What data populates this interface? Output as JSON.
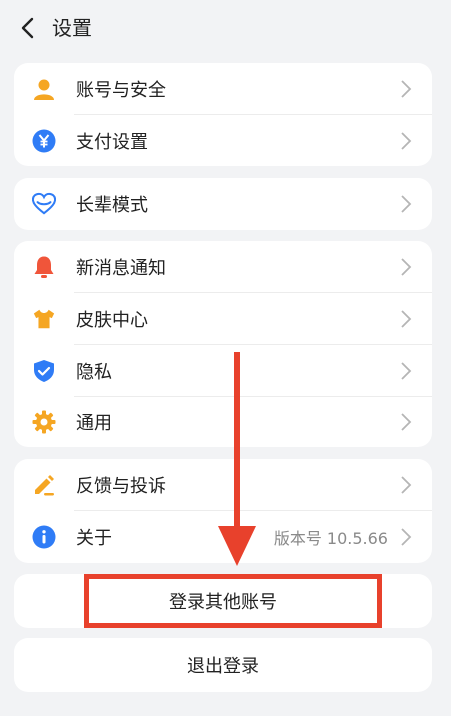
{
  "header": {
    "title": "设置"
  },
  "groups": [
    {
      "items": [
        {
          "label": "账号与安全",
          "icon": "user-icon",
          "color": "#f5a623"
        },
        {
          "label": "支付设置",
          "icon": "yen-icon",
          "color": "#2f7cf6"
        }
      ]
    },
    {
      "items": [
        {
          "label": "长辈模式",
          "icon": "heart-icon",
          "color": "#2f7cf6"
        }
      ]
    },
    {
      "items": [
        {
          "label": "新消息通知",
          "icon": "bell-icon",
          "color": "#f0553a"
        },
        {
          "label": "皮肤中心",
          "icon": "tshirt-icon",
          "color": "#f5a623"
        },
        {
          "label": "隐私",
          "icon": "shield-icon",
          "color": "#2f7cf6"
        },
        {
          "label": "通用",
          "icon": "gear-icon",
          "color": "#f5a623"
        }
      ]
    },
    {
      "items": [
        {
          "label": "反馈与投诉",
          "icon": "pencil-icon",
          "color": "#f5a623"
        },
        {
          "label": "关于",
          "icon": "info-icon",
          "color": "#2f7cf6",
          "extra": "版本号 10.5.66"
        }
      ]
    }
  ],
  "buttons": {
    "switch_account": "登录其他账号",
    "logout": "退出登录"
  },
  "annotation": {
    "color": "#e8412c"
  }
}
